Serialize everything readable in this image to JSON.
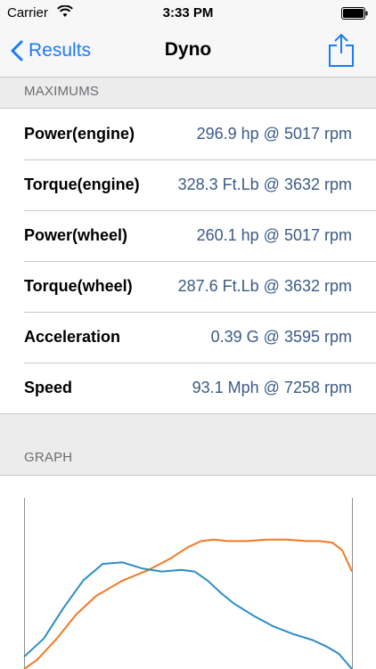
{
  "status_bar": {
    "carrier": "Carrier",
    "time": "3:33 PM",
    "icons": [
      "wifi-icon",
      "battery-icon"
    ]
  },
  "nav": {
    "back_label": "Results",
    "title": "Dyno",
    "back_icon": "chevron-left-icon",
    "share_icon": "share-icon"
  },
  "colors": {
    "accent": "#1a7cf6",
    "value_text": "#3b5a85",
    "power_curve": "#f07a25",
    "torque_curve": "#2b8dc4"
  },
  "maximums": {
    "header": "MAXIMUMS",
    "rows": [
      {
        "label": "Power(engine)",
        "value": "296.9 hp @ 5017 rpm"
      },
      {
        "label": "Torque(engine)",
        "value": "328.3 Ft.Lb @ 3632 rpm"
      },
      {
        "label": "Power(wheel)",
        "value": "260.1 hp @ 5017 rpm"
      },
      {
        "label": "Torque(wheel)",
        "value": "287.6 Ft.Lb @ 3632 rpm"
      },
      {
        "label": "Acceleration",
        "value": "0.39 G @ 3595 rpm"
      },
      {
        "label": "Speed",
        "value": "93.1 Mph @ 7258 rpm"
      }
    ]
  },
  "graph": {
    "header": "GRAPH"
  },
  "chart_data": {
    "type": "line",
    "grid": false,
    "series": [
      {
        "color": "#f07a25",
        "x": [
          0,
          0.04,
          0.1,
          0.16,
          0.22,
          0.3,
          0.38,
          0.45,
          0.5,
          0.54,
          0.58,
          0.62,
          0.68,
          0.74,
          0.8,
          0.86,
          0.9,
          0.94,
          0.97,
          1.0
        ],
        "y": [
          0.0,
          0.06,
          0.2,
          0.36,
          0.48,
          0.58,
          0.65,
          0.73,
          0.8,
          0.84,
          0.85,
          0.84,
          0.84,
          0.85,
          0.85,
          0.84,
          0.84,
          0.83,
          0.78,
          0.64
        ]
      },
      {
        "color": "#2b8dc4",
        "x": [
          0,
          0.06,
          0.12,
          0.18,
          0.24,
          0.3,
          0.36,
          0.42,
          0.48,
          0.52,
          0.56,
          0.6,
          0.64,
          0.7,
          0.76,
          0.82,
          0.88,
          0.92,
          0.96,
          1.0
        ],
        "y": [
          0.08,
          0.2,
          0.4,
          0.58,
          0.69,
          0.7,
          0.66,
          0.64,
          0.65,
          0.64,
          0.58,
          0.5,
          0.43,
          0.35,
          0.28,
          0.23,
          0.19,
          0.15,
          0.1,
          0.0
        ]
      }
    ]
  }
}
